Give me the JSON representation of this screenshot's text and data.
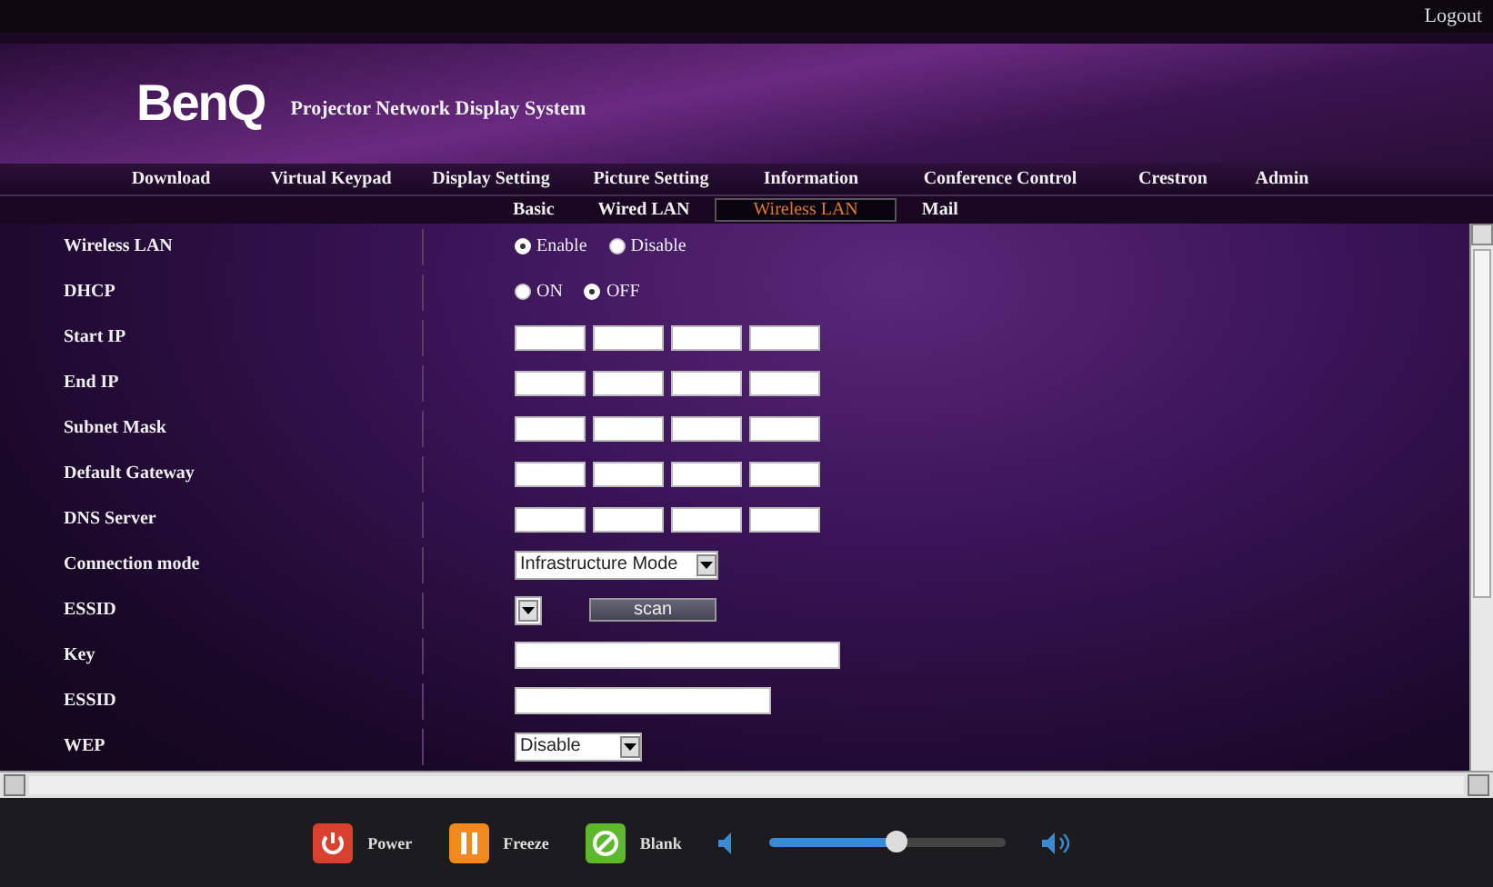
{
  "top_bar": {
    "logout": "Logout"
  },
  "header": {
    "logo": "BenQ",
    "title": "Projector Network Display System"
  },
  "nav": [
    "Download",
    "Virtual Keypad",
    "Display Setting",
    "Picture Setting",
    "Information",
    "Conference Control",
    "Crestron",
    "Admin"
  ],
  "subnav": [
    {
      "label": "Basic",
      "selected": false
    },
    {
      "label": "Wired LAN",
      "selected": false
    },
    {
      "label": "Wireless LAN",
      "selected": true
    },
    {
      "label": "Mail",
      "selected": false
    }
  ],
  "rows": [
    {
      "kind": "radio",
      "label": "Wireless LAN",
      "options": [
        {
          "label": "Enable",
          "selected": true
        },
        {
          "label": "Disable",
          "selected": false
        }
      ]
    },
    {
      "kind": "radio",
      "label": "DHCP",
      "options": [
        {
          "label": "ON",
          "selected": false
        },
        {
          "label": "OFF",
          "selected": true
        }
      ]
    },
    {
      "kind": "ip",
      "label": "Start IP"
    },
    {
      "kind": "ip",
      "label": "End IP"
    },
    {
      "kind": "ip",
      "label": "Subnet Mask"
    },
    {
      "kind": "ip",
      "label": "Default Gateway"
    },
    {
      "kind": "ip",
      "label": "DNS Server"
    },
    {
      "kind": "select",
      "label": "Connection mode",
      "value": "Infrastructure Mode"
    },
    {
      "kind": "scan",
      "label": "ESSID",
      "button": "scan"
    },
    {
      "kind": "widetext",
      "label": "Key"
    },
    {
      "kind": "text",
      "label": "ESSID"
    },
    {
      "kind": "smallselect",
      "label": "WEP",
      "value": "Disable"
    }
  ],
  "bottom_bar": {
    "buttons": [
      {
        "label": "Power",
        "kind": "power",
        "color": "#d9402e"
      },
      {
        "label": "Freeze",
        "kind": "freeze",
        "color": "#f08a1c"
      },
      {
        "label": "Blank",
        "kind": "blank",
        "color": "#5cb82e"
      }
    ],
    "volume": {
      "level": 0.54
    }
  }
}
